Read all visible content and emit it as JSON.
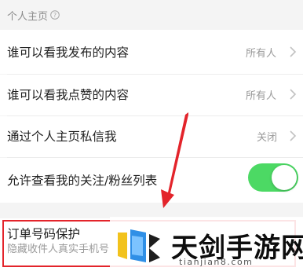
{
  "section": {
    "title": "个人主页"
  },
  "rows": [
    {
      "label": "谁可以看我发布的内容",
      "value": "所有人"
    },
    {
      "label": "谁可以看我点赞的内容",
      "value": "所有人"
    },
    {
      "label": "通过个人主页私信我",
      "value": "关闭"
    }
  ],
  "toggle_row": {
    "label": "允许查看我的关注/粉丝列表",
    "enabled": true
  },
  "order_row": {
    "title": "订单号码保护",
    "subtitle": "隐藏收件人真实手机号"
  },
  "watermark": {
    "brand": "天剑手游网",
    "url": "tianjian8.com"
  },
  "colors": {
    "toggle_on": "#4cd964",
    "highlight": "#e3242b"
  }
}
